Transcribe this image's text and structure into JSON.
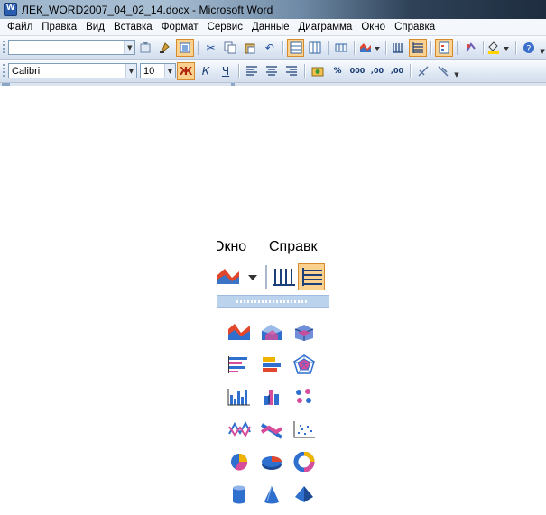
{
  "window": {
    "title": "ЛЕК_WORD2007_04_02_14.docx - Microsoft Word"
  },
  "menu": [
    "Файл",
    "Правка",
    "Вид",
    "Вставка",
    "Формат",
    "Сервис",
    "Данные",
    "Диаграмма",
    "Окно",
    "Справка"
  ],
  "formatting": {
    "font_name": "Calibri",
    "font_size": "10",
    "bold": "Ж",
    "italic": "К",
    "underline": "Ч",
    "percent": "%",
    "thousands": "000",
    "inc_decimal": ",00",
    "dec_decimal": ",00"
  },
  "zoom": {
    "menu_left": "Окно",
    "menu_right": "Справк"
  },
  "chart_types": [
    {
      "name": "area-chart-icon"
    },
    {
      "name": "area-3d-chart-icon"
    },
    {
      "name": "cube-area-chart-icon"
    },
    {
      "name": "bar-horizontal-chart-icon"
    },
    {
      "name": "bar-3d-chart-icon"
    },
    {
      "name": "radar-chart-icon"
    },
    {
      "name": "column-chart-icon"
    },
    {
      "name": "column-3d-chart-icon"
    },
    {
      "name": "bubble-chart-icon"
    },
    {
      "name": "line-chart-icon"
    },
    {
      "name": "line-3d-chart-icon"
    },
    {
      "name": "scatter-chart-icon"
    },
    {
      "name": "pie-chart-icon"
    },
    {
      "name": "pie-3d-chart-icon"
    },
    {
      "name": "doughnut-chart-icon"
    },
    {
      "name": "cylinder-chart-icon"
    },
    {
      "name": "cone-chart-icon"
    },
    {
      "name": "pyramid-chart-icon"
    }
  ]
}
